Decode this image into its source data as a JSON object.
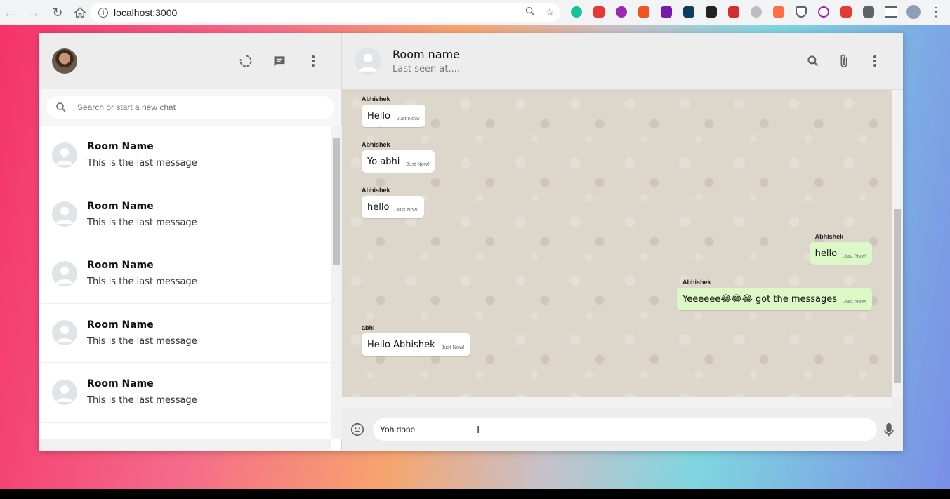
{
  "browser": {
    "url": "localhost:3000",
    "extension_icons": [
      "grammarly-icon",
      "pdf-icon",
      "purple-circle-icon",
      "orange-extension-icon",
      "onenote-icon",
      "m-extension-icon",
      "cb-extension-icon",
      "red-extension-icon",
      "gear-extension-icon",
      "orange-off-extension-icon",
      "pocket-icon",
      "broadcast-icon",
      "red-play-icon",
      "puzzle-icon",
      "reading-list-icon",
      "profile-avatar",
      "more-icon"
    ]
  },
  "sidebar": {
    "search_placeholder": "Search or start a new chat",
    "chats": [
      {
        "name": "Room Name",
        "last_message": "This is the last message"
      },
      {
        "name": "Room Name",
        "last_message": "This is the last message"
      },
      {
        "name": "Room Name",
        "last_message": "This is the last message"
      },
      {
        "name": "Room Name",
        "last_message": "This is the last message"
      },
      {
        "name": "Room Name",
        "last_message": "This is the last message"
      }
    ]
  },
  "chat": {
    "room_name": "Room name",
    "last_seen": "Last seen at....",
    "messages": [
      {
        "sender": "Abhishek",
        "text": "Hello",
        "time": "Just Now!",
        "sent": false
      },
      {
        "sender": "Abhishek",
        "text": "Yo abhi",
        "time": "Just Now!",
        "sent": false
      },
      {
        "sender": "Abhishek",
        "text": "hello",
        "time": "Just Now!",
        "sent": false
      },
      {
        "sender": "Abhishek",
        "text": "hello",
        "time": "Just Now!",
        "sent": true
      },
      {
        "sender": "Abhishek",
        "text": "Yeeeeee😂😂😂 got the messages",
        "time": "Just Now!",
        "sent": true
      },
      {
        "sender": "abhi",
        "text": "Hello Abhishek",
        "time": "Just Now!",
        "sent": false
      }
    ],
    "input_value": "Yoh done"
  },
  "colors": {
    "sent_bubble": "#dcf8c6",
    "received_bubble": "#ffffff",
    "header_bg": "#ededed"
  }
}
